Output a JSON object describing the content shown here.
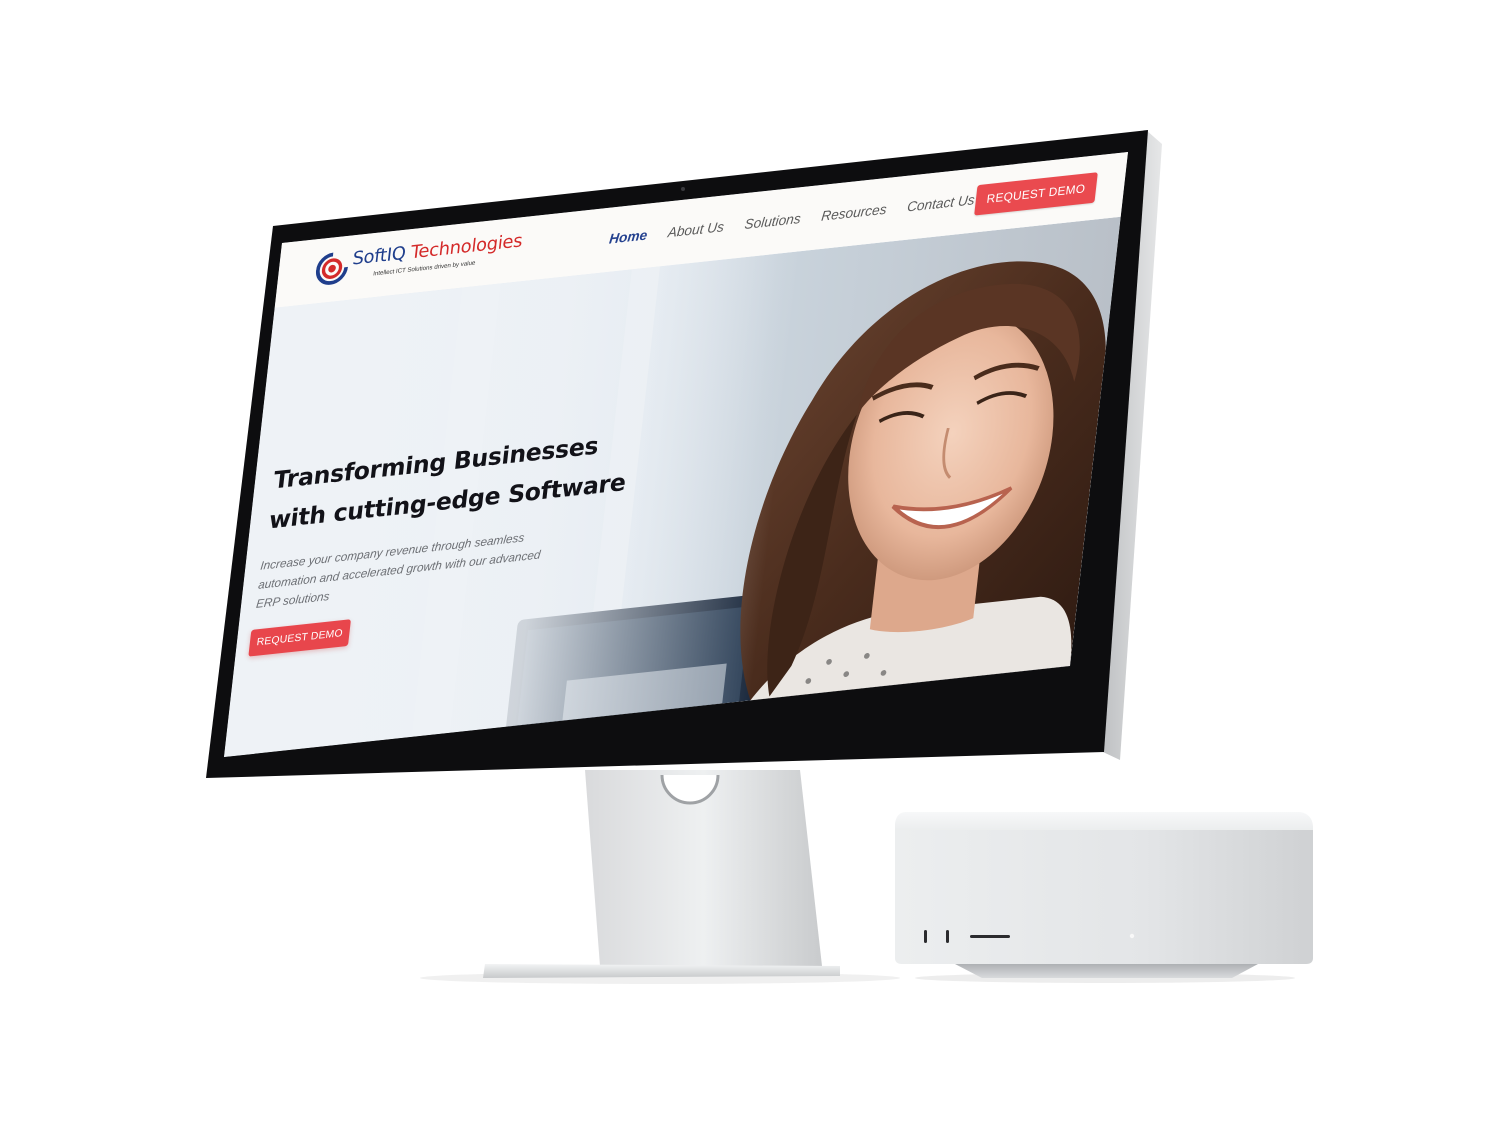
{
  "site": {
    "brand": {
      "name_part1": "SoftIQ",
      "name_part2": "Technologies",
      "tagline": "Intellect ICT Solutions driven by value",
      "colors": {
        "primary": "#1f3e8c",
        "secondary": "#d42a2a"
      }
    },
    "nav": {
      "items": [
        {
          "label": "Home",
          "active": true
        },
        {
          "label": "About Us",
          "active": false
        },
        {
          "label": "Solutions",
          "active": false
        },
        {
          "label": "Resources",
          "active": false
        },
        {
          "label": "Contact Us",
          "active": false
        }
      ],
      "cta_label": "REQUEST DEMO"
    },
    "hero": {
      "title_line1": "Transforming Businesses",
      "title_line2": "with cutting-edge Software",
      "subtitle_line1": "Increase your company revenue through seamless",
      "subtitle_line2": "automation and accelerated growth with our advanced",
      "subtitle_line3": "ERP solutions",
      "cta_label": "REQUEST DEMO",
      "accent_color": "#e8464c"
    }
  },
  "icons": {
    "logo_mark": "concentric-ring-logo-icon",
    "camera": "webcam-dot-icon"
  }
}
